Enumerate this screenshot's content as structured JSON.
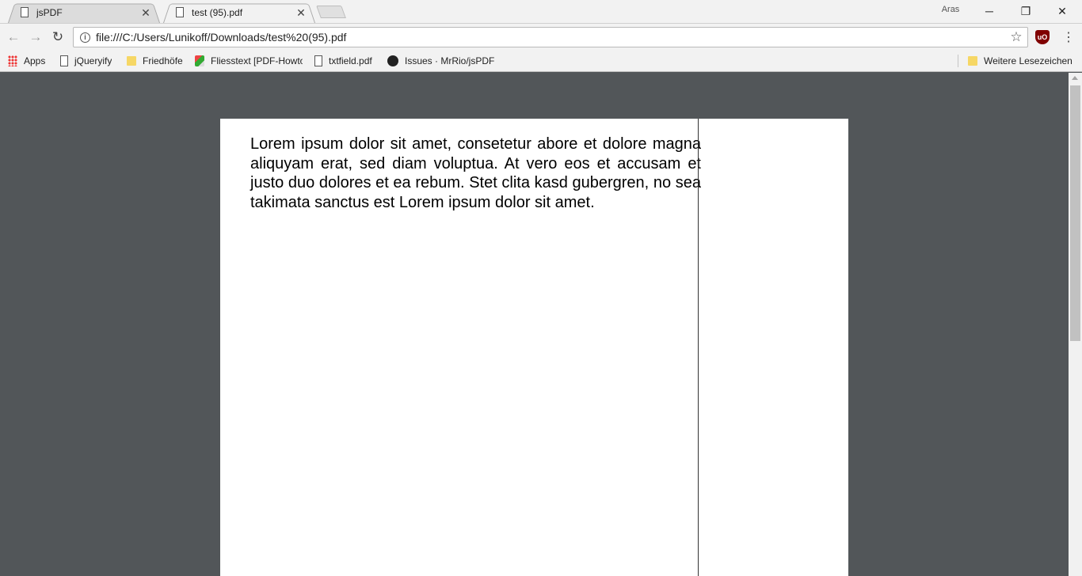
{
  "tabs": [
    {
      "title": "jsPDF",
      "active": false
    },
    {
      "title": "test (95).pdf",
      "active": true
    }
  ],
  "profile": {
    "name": "Aras"
  },
  "toolbar": {
    "url": "file:///C:/Users/Lunikoff/Downloads/test%20(95).pdf",
    "extension": "uBlock"
  },
  "bookmarks": {
    "items": [
      {
        "label": "Apps",
        "icon": "apps-grid-icon"
      },
      {
        "label": "jQueryify",
        "icon": "page-icon"
      },
      {
        "label": "Friedhöfe",
        "icon": "folder-icon"
      },
      {
        "label": "Fliesstext [PDF-Howto",
        "icon": "favicon-icon"
      },
      {
        "label": "txtfield.pdf",
        "icon": "page-icon"
      },
      {
        "label": "Issues · MrRio/jsPDF",
        "icon": "github-icon"
      }
    ],
    "other": "Weitere Lesezeichen"
  },
  "pdf": {
    "text": "Lorem ipsum dolor sit amet, consetetur abore et dolore magna aliquyam erat, sed diam voluptua. At vero eos et accusam et justo duo dolores et ea rebum. Stet clita kasd gubergren, no sea takimata sanctus est Lorem ipsum dolor sit amet."
  },
  "colors": {
    "viewer_background": "#525659",
    "chrome_background": "#f2f2f2",
    "page_background": "#ffffff"
  }
}
